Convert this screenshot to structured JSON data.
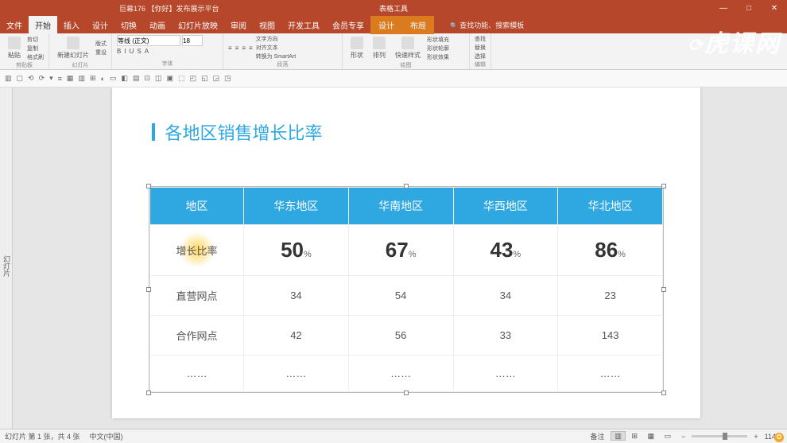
{
  "titlebar": {
    "doc_title": "巨幕176 【你好】发布展示平台",
    "center_title": "表格工具"
  },
  "window_controls": {
    "minimize": "—",
    "maximize": "□",
    "close": "✕"
  },
  "menu": {
    "tabs": [
      "文件",
      "开始",
      "插入",
      "设计",
      "切换",
      "动画",
      "幻灯片放映",
      "审阅",
      "视图",
      "开发工具",
      "会员专享"
    ],
    "contextual": [
      "设计",
      "布局"
    ],
    "search_placeholder": "查找功能、搜索模板"
  },
  "ribbon": {
    "groups": [
      {
        "label": "剪贴板",
        "items": [
          "粘贴",
          "剪切",
          "复制",
          "格式刷"
        ]
      },
      {
        "label": "幻灯片",
        "items": [
          "新建幻灯片",
          "版式",
          "重设"
        ]
      },
      {
        "label": "字体",
        "font_name": "等线 (正文)",
        "font_size": "18",
        "items": [
          "B",
          "I",
          "U",
          "S",
          "A"
        ]
      },
      {
        "label": "段落",
        "items": [
          "≡",
          "≡",
          "≡",
          "≡",
          "文字方向",
          "对齐文本",
          "转换为 SmartArt"
        ]
      },
      {
        "label": "绘图",
        "items": [
          "形状",
          "排列",
          "快速样式",
          "形状填充",
          "形状轮廓",
          "形状效果"
        ]
      },
      {
        "label": "编辑",
        "items": [
          "查找",
          "替换",
          "选择"
        ]
      }
    ]
  },
  "qat_icons": [
    "▥",
    "▢",
    "⟲",
    "⟳",
    "▾",
    "≡",
    "▦",
    "▥",
    "⊞",
    "◐",
    "▭",
    "◧",
    "▤",
    "⊡",
    "◫",
    "▣",
    "⬚",
    "◰",
    "◱",
    "◲",
    "◳"
  ],
  "side_tab": "幻灯片",
  "slide": {
    "title": "各地区销售增长比率"
  },
  "chart_data": {
    "type": "table",
    "headers": [
      "地区",
      "华东地区",
      "华南地区",
      "华西地区",
      "华北地区"
    ],
    "rows": [
      {
        "label": "增长比率",
        "is_percent": true,
        "values": [
          "50",
          "67",
          "43",
          "86"
        ]
      },
      {
        "label": "直营网点",
        "values": [
          "34",
          "54",
          "34",
          "23"
        ]
      },
      {
        "label": "合作网点",
        "values": [
          "42",
          "56",
          "33",
          "143"
        ]
      },
      {
        "label": "……",
        "values": [
          "……",
          "……",
          "……",
          "……"
        ]
      }
    ],
    "percent_suffix": "%"
  },
  "statusbar": {
    "slide_info": "幻灯片 第 1 张，共 4 张",
    "language": "中文(中国)",
    "notes": "备注",
    "views": [
      "▥",
      "⊞",
      "▦",
      "▭"
    ],
    "zoom_minus": "−",
    "zoom_plus": "+",
    "zoom": "114%"
  },
  "watermark": "虎课网"
}
